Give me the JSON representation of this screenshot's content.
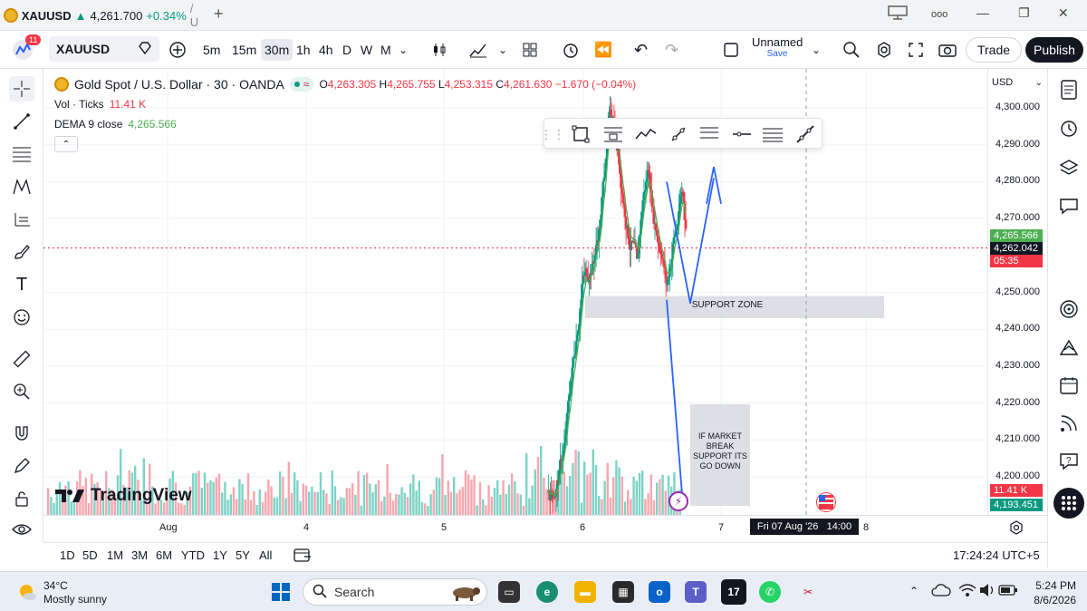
{
  "browser": {
    "tab_symbol": "XAUUSD",
    "tab_price": "4,261.700",
    "tab_change": "+0.34%",
    "tab_rest": "/ U",
    "new_tab": "+",
    "menu_dots": "ooo",
    "minimize": "—",
    "restore": "❐",
    "close": "✕"
  },
  "toolbar": {
    "notif_badge": "11",
    "symbol": "XAUUSD",
    "intervals": [
      "5m",
      "15m",
      "30m",
      "1h",
      "4h",
      "D",
      "W",
      "M"
    ],
    "active_interval": "30m",
    "layout_name": "Unnamed",
    "layout_status": "Save",
    "trade": "Trade",
    "publish": "Publish"
  },
  "legend": {
    "title": "Gold Spot / U.S. Dollar · 30 · OANDA",
    "o_label": "O",
    "o_value": "4,263.305",
    "h_label": "H",
    "h_value": "4,265.755",
    "l_label": "L",
    "l_value": "4,253.315",
    "c_label": "C",
    "c_value": "4,261.630",
    "change": "−1.670 (−0.04%)",
    "vol_label": "Vol · Ticks",
    "vol_value": "11.41 K",
    "dema_label": "DEMA 9 close",
    "dema_value": "4,265.566"
  },
  "annotations": {
    "support_zone": "SUPPORT ZONE",
    "break_note": "IF MARKET BREAK SUPPORT ITS GO DOWN"
  },
  "watermark": "TradingView",
  "price_axis": {
    "currency": "USD",
    "ticks": [
      "4,300.000",
      "4,290.000",
      "4,280.000",
      "4,270.000",
      "4,250.000",
      "4,240.000",
      "4,230.000",
      "4,220.000",
      "4,210.000",
      "4,200.000"
    ],
    "dema_tag": "4,265.566",
    "price_tag": "4,262.042",
    "countdown": "05:35",
    "vol_tag": "11.41 K",
    "cross_tag": "4,193.451"
  },
  "time_axis": {
    "labels": [
      "Aug",
      "4",
      "5",
      "6",
      "7",
      "8"
    ],
    "crosshair": "Fri 07 Aug '26   14:00"
  },
  "range_bar": {
    "ranges": [
      "1D",
      "5D",
      "1M",
      "3M",
      "6M",
      "YTD",
      "1Y",
      "5Y",
      "All"
    ],
    "clock": "17:24:24 UTC+5"
  },
  "taskbar": {
    "temp": "34°C",
    "weather": "Mostly sunny",
    "search": "Search",
    "time": "5:24 PM",
    "date": "8/6/2026"
  },
  "chart_data": {
    "type": "candlestick",
    "symbol": "XAUUSD",
    "timeframe": "30",
    "ylim": [
      4190,
      4305
    ],
    "support_zone": [
      4243,
      4249
    ],
    "series": [
      {
        "name": "DEMA 9 close",
        "last": 4265.566
      }
    ],
    "ohlc_last": {
      "open": 4263.305,
      "high": 4265.755,
      "low": 4253.315,
      "close": 4261.63
    },
    "last_price": 4262.042
  },
  "colors": {
    "up": "#089981",
    "down": "#f23645",
    "dema": "#4caf50",
    "drawing": "#2962ff",
    "zone": "#d1d4dc"
  }
}
